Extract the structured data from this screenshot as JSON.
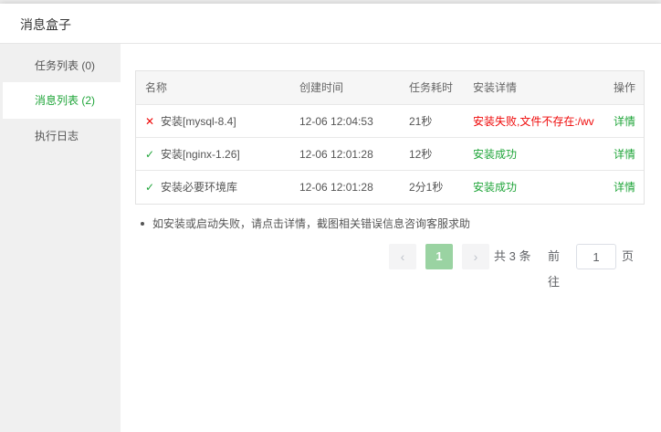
{
  "dialog": {
    "title": "消息盒子"
  },
  "sidebar": {
    "items": [
      {
        "label": "任务列表 (0)",
        "active": false
      },
      {
        "label": "消息列表 (2)",
        "active": true
      },
      {
        "label": "执行日志",
        "active": false
      }
    ]
  },
  "table": {
    "headers": {
      "name": "名称",
      "created": "创建时间",
      "duration": "任务耗时",
      "detail": "安装详情",
      "action": "操作"
    },
    "rows": [
      {
        "status": "fail",
        "name": "安装[mysql-8.4]",
        "created": "12-06 12:04:53",
        "duration": "21秒",
        "detail": "安装失败,文件不存在:/wv",
        "action": "详情"
      },
      {
        "status": "ok",
        "name": "安装[nginx-1.26]",
        "created": "12-06 12:01:28",
        "duration": "12秒",
        "detail": "安装成功",
        "action": "详情"
      },
      {
        "status": "ok",
        "name": "安装必要环境库",
        "created": "12-06 12:01:28",
        "duration": "2分1秒",
        "detail": "安装成功",
        "action": "详情"
      }
    ]
  },
  "note": "如安装或启动失败，请点击详情，截图相关错误信息咨询客服求助",
  "pagination": {
    "prev_icon": "chevron-left-icon",
    "next_icon": "chevron-right-icon",
    "current_page": "1",
    "total_text": "共 3 条",
    "goto_label": "前往",
    "goto_value": "1",
    "page_unit": "页"
  },
  "icons": {
    "fail": "close-icon",
    "ok": "check-icon"
  },
  "colors": {
    "accent": "#20a53a",
    "error": "#ef0808",
    "page_active": "#9ad3a2"
  }
}
